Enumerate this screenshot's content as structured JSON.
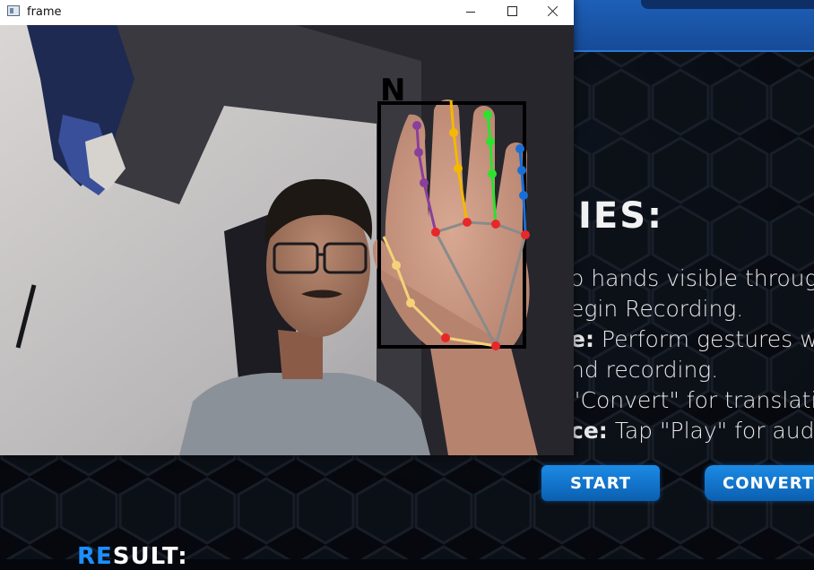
{
  "window": {
    "title": "frame"
  },
  "overlay": {
    "detected_letter": "N"
  },
  "app": {
    "instructions": {
      "title": "IES:",
      "lines": [
        {
          "bold": "",
          "text": "o hands visible through"
        },
        {
          "bold": "",
          "text": "egin Recording."
        },
        {
          "bold": "e:",
          "text": " Perform gestures w"
        },
        {
          "bold": "",
          "text": "nd recording."
        },
        {
          "bold": "",
          "text": "\"Convert\" for translatio"
        },
        {
          "bold": "ce:",
          "text": " Tap \"Play\" for audio"
        }
      ]
    },
    "buttons": {
      "start": "START",
      "convert": "CONVERT"
    },
    "result": {
      "accent": "RE",
      "rest": "SULT:"
    }
  },
  "colors": {
    "accent": "#1c8fff",
    "header": "#1d5fb8",
    "landmark_joint": "#e8272a",
    "thumb": "#f4d27a",
    "index": "#8a3f9a",
    "middle": "#f5b800",
    "ring": "#2fe02f",
    "pinky": "#1a6fd6",
    "palm": "#8a8a8a"
  }
}
